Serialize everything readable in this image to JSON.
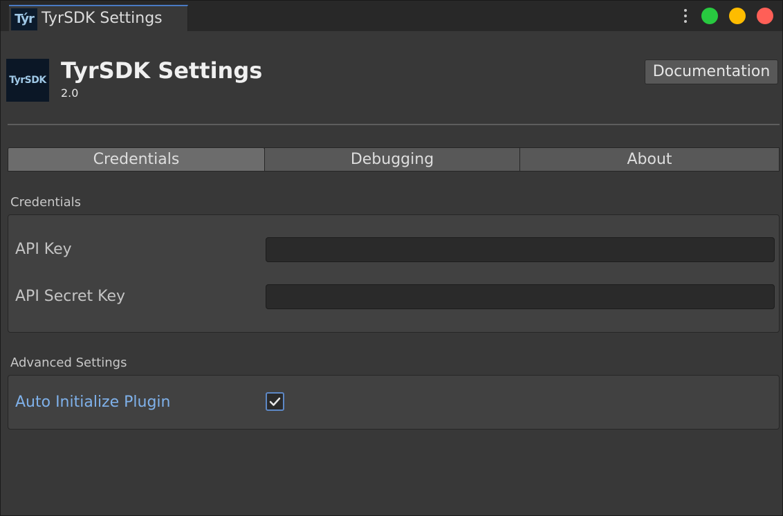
{
  "window": {
    "tab_icon_text": "Týr",
    "tab_title": "TyrSDK Settings",
    "controls": {
      "menu_icon": "kebab-icon",
      "green": "#28c940",
      "yellow": "#febc00",
      "red": "#ff5f57"
    }
  },
  "header": {
    "logo_text": "TyrSDK",
    "title": "TyrSDK Settings",
    "version": "2.0",
    "doc_button": "Documentation"
  },
  "tabs": [
    {
      "label": "Credentials",
      "active": true
    },
    {
      "label": "Debugging",
      "active": false
    },
    {
      "label": "About",
      "active": false
    }
  ],
  "credentials": {
    "section_label": "Credentials",
    "api_key_label": "API Key",
    "api_key_value": "",
    "api_secret_label": "API Secret Key",
    "api_secret_value": ""
  },
  "advanced": {
    "section_label": "Advanced Settings",
    "auto_init_label": "Auto Initialize Plugin",
    "auto_init_checked": true
  },
  "colors": {
    "accent": "#4a7bc4",
    "link_label": "#7fb1ea",
    "background": "#383838"
  }
}
